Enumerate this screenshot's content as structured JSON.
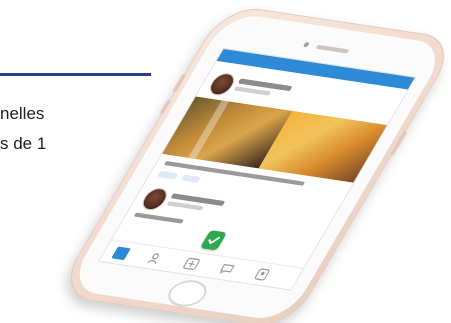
{
  "background_fragment": {
    "line_1": "nelles",
    "line_2": "s de 1",
    "accent_color": "#2f3f8a"
  },
  "phone": {
    "device": "smartphone",
    "color": "rose-gold",
    "app_theme_color": "#2d8ad7",
    "fab_color": "#2fa84f",
    "screen": {
      "tab_icons": [
        "home-icon",
        "people-icon",
        "add-icon",
        "messages-icon",
        "profile-icon"
      ]
    }
  }
}
